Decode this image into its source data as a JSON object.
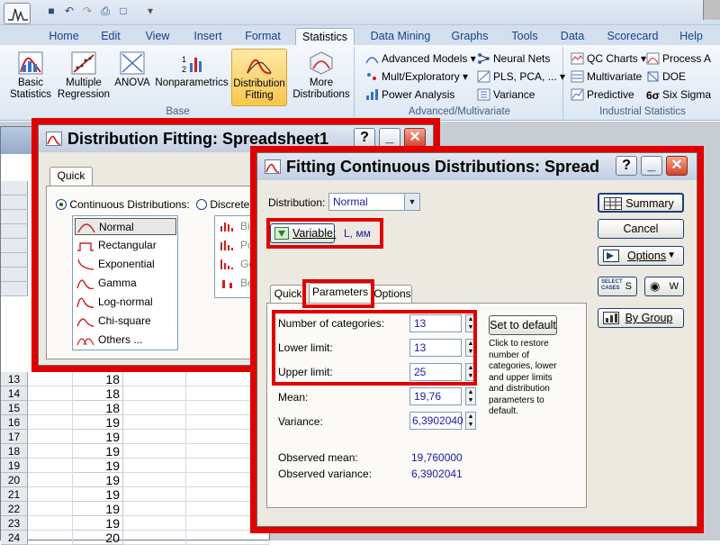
{
  "ribbon": {
    "tabs": [
      "Home",
      "Edit",
      "View",
      "Insert",
      "Format",
      "Statistics",
      "Data Mining",
      "Graphs",
      "Tools",
      "Data",
      "Scorecard",
      "Help"
    ],
    "active_tab": "Statistics",
    "base_group": {
      "label": "Base",
      "basic_statistics": "Basic Statistics",
      "multiple_regression": "Multiple Regression",
      "anova": "ANOVA",
      "nonparametrics": "Nonparametrics",
      "distribution_fitting": "Distribution Fitting",
      "more_distributions": "More Distributions"
    },
    "advanced_group": {
      "label": "Advanced/Multivariate",
      "advanced_models": "Advanced Models",
      "mult_exploratory": "Mult/Exploratory",
      "power_analysis": "Power Analysis",
      "neural_nets": "Neural Nets",
      "pls_pca": "PLS, PCA, ...",
      "variance": "Variance"
    },
    "industrial_group": {
      "label": "Industrial Statistics",
      "qc_charts": "QC Charts",
      "multivariate": "Multivariate",
      "predictive": "Predictive",
      "process_a": "Process A",
      "doe": "DOE",
      "six_sigma": "Six Sigma"
    }
  },
  "spreadsheet": {
    "rows": [
      {
        "num": "13",
        "val": "18"
      },
      {
        "num": "14",
        "val": "18"
      },
      {
        "num": "15",
        "val": "18"
      },
      {
        "num": "16",
        "val": "19"
      },
      {
        "num": "17",
        "val": "19"
      },
      {
        "num": "18",
        "val": "19"
      },
      {
        "num": "19",
        "val": "19"
      },
      {
        "num": "20",
        "val": "19"
      },
      {
        "num": "21",
        "val": "19"
      },
      {
        "num": "22",
        "val": "19"
      },
      {
        "num": "23",
        "val": "19"
      },
      {
        "num": "24",
        "val": "20"
      }
    ]
  },
  "dist_dialog": {
    "title": "Distribution Fitting: Spreadsheet1",
    "tab": "Quick",
    "continuous_label": "Continuous Distributions:",
    "discrete_label": "Discrete D",
    "continuous": [
      "Normal",
      "Rectangular",
      "Exponential",
      "Gamma",
      "Log-normal",
      "Chi-square",
      "Others ..."
    ],
    "discrete": [
      "Bino",
      "Pois",
      "Geo",
      "Bern"
    ]
  },
  "fit_dialog": {
    "title": "Fitting Continuous Distributions: Spread",
    "distribution_label": "Distribution:",
    "distribution_value": "Normal",
    "variable_button": "Variable:",
    "variable_value": "L, мм",
    "tabs": [
      "Quick",
      "Parameters",
      "Options"
    ],
    "active_tab": "Parameters",
    "num_categories_label": "Number of categories:",
    "num_categories": "13",
    "lower_limit_label": "Lower limit:",
    "lower_limit": "13",
    "upper_limit_label": "Upper limit:",
    "upper_limit": "25",
    "mean_label": "Mean:",
    "mean": "19,76",
    "variance_label": "Variance:",
    "variance": "6,3902040",
    "set_default": "Set to default",
    "restore_note": "Click to restore number of categories, lower and upper limits and distribution parameters to default.",
    "observed_mean_label": "Observed mean:",
    "observed_mean": "19,760000",
    "observed_variance_label": "Observed variance:",
    "observed_variance": "6,3902041",
    "summary": "Summary",
    "cancel": "Cancel",
    "options": "Options",
    "select_cases": "SELECT CASES",
    "s_label": "S",
    "w_label": "W",
    "by_group": "By Group"
  },
  "colors": {
    "highlight_red": "#e00000",
    "value_blue": "#1a1aa8"
  }
}
